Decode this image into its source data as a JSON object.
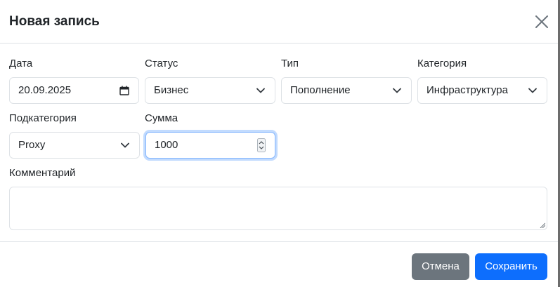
{
  "dialog": {
    "title": "Новая запись"
  },
  "form": {
    "date": {
      "label": "Дата",
      "value": "20.09.2025"
    },
    "status": {
      "label": "Статус",
      "value": "Бизнес"
    },
    "type": {
      "label": "Тип",
      "value": "Пополнение"
    },
    "category": {
      "label": "Категория",
      "value": "Инфраструктура"
    },
    "subcategory": {
      "label": "Подкатегория",
      "value": "Proxy"
    },
    "amount": {
      "label": "Сумма",
      "value": "1000"
    },
    "comment": {
      "label": "Комментарий",
      "value": ""
    }
  },
  "footer": {
    "cancel_label": "Отмена",
    "save_label": "Сохранить"
  },
  "icons": {
    "close": "close-icon",
    "calendar": "calendar-icon",
    "chevron": "chevron-down-icon",
    "spinner": "number-spinner-icon",
    "resize": "resize-grip-icon"
  },
  "colors": {
    "primary": "#0d6efd",
    "secondary": "#6c757d",
    "border": "#dee2e6",
    "focus_border": "#86b7fe"
  }
}
